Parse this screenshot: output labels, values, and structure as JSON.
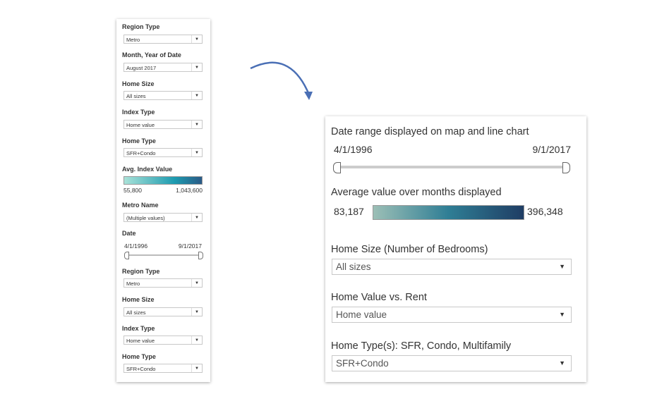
{
  "left_panel": {
    "filters": [
      {
        "label": "Region Type",
        "value": "Metro"
      },
      {
        "label": "Month, Year of Date",
        "value": "August 2017"
      },
      {
        "label": "Home Size",
        "value": "All sizes"
      },
      {
        "label": "Index Type",
        "value": "Home value"
      },
      {
        "label": "Home Type",
        "value": "SFR+Condo"
      }
    ],
    "legend": {
      "label": "Avg. Index Value",
      "min": "55,800",
      "max": "1,043,600",
      "color_start": "#a9e2d8",
      "color_mid": "#1d9bb0",
      "color_end": "#2a5a86"
    },
    "metro": {
      "label": "Metro Name",
      "value": "(Multiple values)"
    },
    "date": {
      "label": "Date",
      "start": "4/1/1996",
      "end": "9/1/2017"
    },
    "filters2": [
      {
        "label": "Region Type",
        "value": "Metro"
      },
      {
        "label": "Home Size",
        "value": "All sizes"
      },
      {
        "label": "Index Type",
        "value": "Home value"
      },
      {
        "label": "Home Type",
        "value": "SFR+Condo"
      }
    ]
  },
  "right_panel": {
    "date_range": {
      "label": "Date range displayed on map and line chart",
      "start": "4/1/1996",
      "end": "9/1/2017"
    },
    "legend": {
      "label": "Average value over months displayed",
      "min": "83,187",
      "max": "396,348",
      "color_start": "#9cbfb6",
      "color_mid": "#2f7e95",
      "color_end": "#1f3d64"
    },
    "home_size": {
      "label": "Home Size (Number of Bedrooms)",
      "value": "All sizes"
    },
    "value_rent": {
      "label": "Home Value vs. Rent",
      "value": "Home value"
    },
    "home_type": {
      "label": "Home Type(s): SFR, Condo, Multifamily",
      "value": "SFR+Condo"
    }
  },
  "arrow_color": "#4a6fb5"
}
